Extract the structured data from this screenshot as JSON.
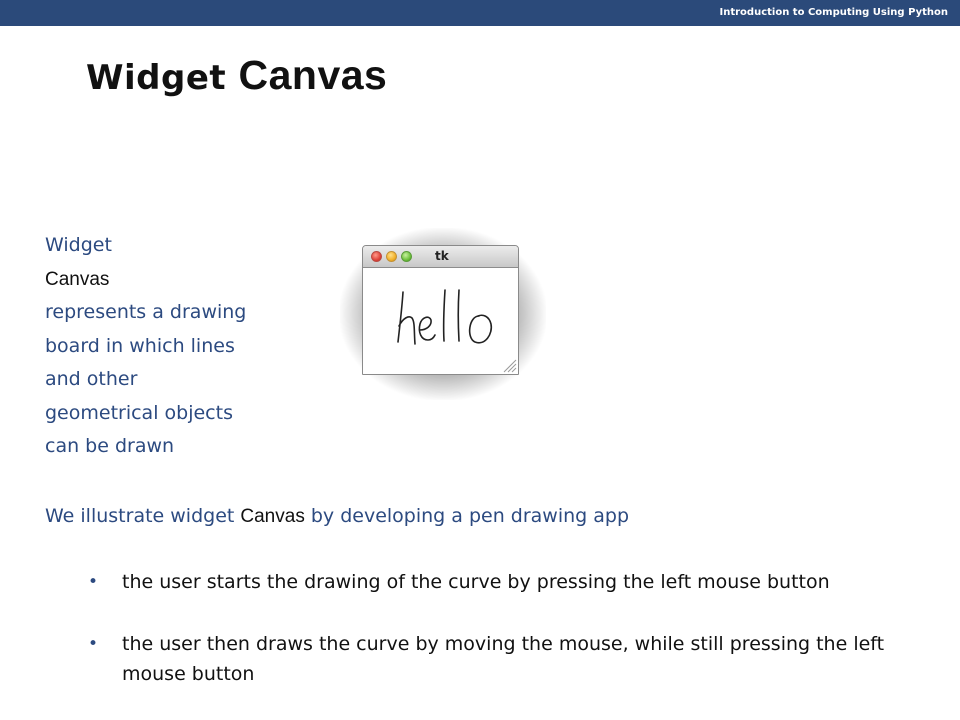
{
  "header": {
    "course_title": "Introduction to Computing Using Python"
  },
  "slide": {
    "title_plain": "Widget",
    "title_code": "Canvas",
    "side_text": {
      "line1_plain": "Widget",
      "line1_code": "Canvas",
      "line2": "represents a drawing",
      "line3": "board in which lines",
      "line4": "and other",
      "line5": "geometrical objects",
      "line6": "can be drawn"
    },
    "tk_window": {
      "title": "tk",
      "drawn_text": "hello"
    },
    "intro": {
      "before": "We illustrate widget",
      "code": "Canvas",
      "after": "by developing a pen drawing app"
    },
    "bullets": [
      {
        "text": "the user starts the drawing of the curve by pressing the left mouse button"
      },
      {
        "text": "the user then draws the curve by moving the mouse, while still pressing the left mouse button"
      }
    ]
  },
  "colors": {
    "header_bar": "#2b4a7a",
    "body_text": "#2c4a80",
    "bullet_text": "#111111"
  }
}
